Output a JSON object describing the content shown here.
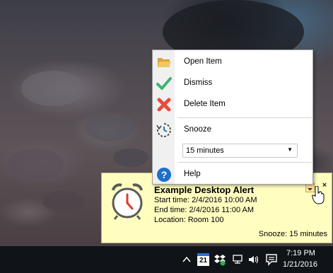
{
  "menu": {
    "items": [
      {
        "label": "Open Item",
        "icon": "folder-open-icon"
      },
      {
        "label": "Dismiss",
        "icon": "checkmark-icon"
      },
      {
        "label": "Delete Item",
        "icon": "red-x-icon"
      },
      {
        "label": "Snooze",
        "icon": "snooze-clock-icon"
      },
      {
        "label": "Help",
        "icon": "help-icon"
      }
    ],
    "snooze_option": "15 minutes"
  },
  "alert": {
    "title": "Example Desktop Alert",
    "start": "Start time: 2/4/2016 10:00 AM",
    "end": "End time: 2/4/2016 11:00 AM",
    "location": "Location: Room 100",
    "snooze": "Snooze: 15 minutes",
    "close_glyph": "×"
  },
  "taskbar": {
    "calendar_day": "21",
    "time": "7:19 PM",
    "date": "1/21/2016"
  },
  "colors": {
    "alert_bg": "#fffebf",
    "check_green": "#3cb371",
    "delete_red": "#e74c3c",
    "help_blue": "#1e6fc9",
    "folder_yellow": "#e8b94a"
  }
}
